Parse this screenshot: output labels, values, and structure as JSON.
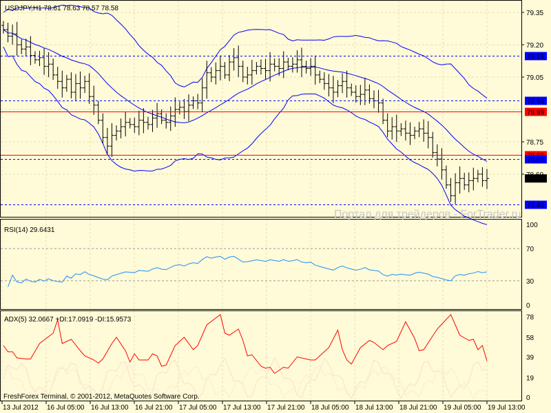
{
  "header": {
    "symbol_info": "USDJPY,H1  78.61 78.63 78.57 78.58"
  },
  "watermark": "Портал для трейдеров - ForTrader.ru",
  "footer": {
    "copyright": "FreshForex Terminal, © 2001-2012, MetaQuotes Software Corp."
  },
  "colors": {
    "background": "#fffad7",
    "bars": "#000000",
    "bands": "#0000ff",
    "level_red": "#ff0000",
    "level_blue": "#0000ff",
    "rsi": "#1e90ff",
    "adx": "#ff0000",
    "grid": "#e6e0b8"
  },
  "chart_data": [
    {
      "type": "bar",
      "title": "USDJPY,H1",
      "price_ticks": [
        "79.35",
        "79.20",
        "79.05",
        "78.75",
        "78.60"
      ],
      "ylim": [
        78.43,
        79.4
      ],
      "closes": [
        79.27,
        79.24,
        79.25,
        79.2,
        79.18,
        79.19,
        79.15,
        79.13,
        79.14,
        79.1,
        79.11,
        79.06,
        79.03,
        79.0,
        79.04,
        78.98,
        79.02,
        79.0,
        79.03,
        78.96,
        78.92,
        78.85,
        78.77,
        78.73,
        78.78,
        78.8,
        78.82,
        78.84,
        78.83,
        78.82,
        78.85,
        78.84,
        78.83,
        78.86,
        78.88,
        78.85,
        78.84,
        78.87,
        78.9,
        78.91,
        78.89,
        78.92,
        78.94,
        78.93,
        79.0,
        79.07,
        79.05,
        79.08,
        79.1,
        79.06,
        79.12,
        79.14,
        79.1,
        79.05,
        79.06,
        79.08,
        79.1,
        79.09,
        79.08,
        79.11,
        79.1,
        79.09,
        79.12,
        79.1,
        79.11,
        79.13,
        79.1,
        79.09,
        79.1,
        79.06,
        79.04,
        79.02,
        79.0,
        78.98,
        79.01,
        79.03,
        79.0,
        78.98,
        78.96,
        78.97,
        78.99,
        78.95,
        78.94,
        78.93,
        78.85,
        78.8,
        78.82,
        78.8,
        78.81,
        78.79,
        78.78,
        78.8,
        78.81,
        78.79,
        78.77,
        78.7,
        78.67,
        78.62,
        78.55,
        78.5,
        78.56,
        78.58,
        78.55,
        78.57,
        78.58,
        78.6,
        78.57,
        78.58
      ],
      "levels": [
        {
          "price": 79.15,
          "label": "79.15",
          "style": "blue-dashed"
        },
        {
          "price": 78.94,
          "label": "78.94",
          "style": "blue-dashed"
        },
        {
          "price": 78.89,
          "label": "78.89",
          "style": "red-solid"
        },
        {
          "price": 78.69,
          "label": "78.69",
          "style": "red-solid"
        },
        {
          "price": 78.67,
          "label": "78.67",
          "style": "blue-dashed"
        },
        {
          "price": 78.46,
          "label": "78.46",
          "style": "blue-dashed"
        }
      ],
      "current_price": "78.58"
    },
    {
      "type": "line",
      "title": "RSI(14) 29.6431",
      "ylim": [
        0,
        100
      ],
      "ticks": [
        "100",
        "70",
        "30",
        "0"
      ],
      "levels": [
        70,
        30
      ]
    },
    {
      "type": "line",
      "title": "ADX(5) 32.0667 +DI:17.0919 -DI:15.9573",
      "ylim": [
        0,
        78
      ],
      "ticks": [
        "78",
        "58",
        "39",
        "19",
        "0"
      ],
      "adx_points": [
        [
          0,
          50
        ],
        [
          1,
          44
        ],
        [
          2,
          44
        ],
        [
          3,
          38
        ],
        [
          5,
          37
        ],
        [
          6,
          37
        ],
        [
          8,
          52
        ],
        [
          11,
          62
        ],
        [
          12,
          75
        ],
        [
          13,
          52
        ],
        [
          15,
          56
        ],
        [
          17,
          45
        ],
        [
          18,
          40
        ],
        [
          20,
          36
        ],
        [
          21,
          33
        ],
        [
          22,
          37
        ],
        [
          24,
          52
        ],
        [
          25,
          58
        ],
        [
          27,
          45
        ],
        [
          28,
          34
        ],
        [
          29,
          42
        ],
        [
          30,
          36
        ],
        [
          32,
          36
        ],
        [
          33,
          42
        ],
        [
          34,
          40
        ],
        [
          35,
          30
        ],
        [
          36,
          31
        ],
        [
          38,
          50
        ],
        [
          40,
          58
        ],
        [
          42,
          46
        ],
        [
          43,
          50
        ],
        [
          45,
          70
        ],
        [
          48,
          80
        ],
        [
          49,
          62
        ],
        [
          50,
          60
        ],
        [
          52,
          66
        ],
        [
          53,
          55
        ],
        [
          54,
          40
        ],
        [
          55,
          41
        ],
        [
          57,
          30
        ],
        [
          58,
          28
        ],
        [
          59,
          29
        ],
        [
          60,
          23
        ],
        [
          62,
          29
        ],
        [
          63,
          28
        ],
        [
          65,
          39
        ],
        [
          68,
          36
        ],
        [
          69,
          36
        ],
        [
          72,
          48
        ],
        [
          74,
          65
        ],
        [
          75,
          46
        ],
        [
          76,
          36
        ],
        [
          77,
          32
        ],
        [
          79,
          48
        ],
        [
          81,
          55
        ],
        [
          82,
          53
        ],
        [
          84,
          46
        ],
        [
          85,
          50
        ],
        [
          87,
          54
        ],
        [
          89,
          73
        ],
        [
          91,
          57
        ],
        [
          92,
          45
        ],
        [
          93,
          46
        ],
        [
          96,
          66
        ],
        [
          99,
          80
        ],
        [
          101,
          60
        ],
        [
          103,
          55
        ],
        [
          104,
          56
        ],
        [
          105,
          46
        ],
        [
          106,
          50
        ],
        [
          107,
          35
        ]
      ]
    }
  ],
  "time_axis": [
    "13 Jul 2012",
    "16 Jul 05:00",
    "16 Jul 13:00",
    "16 Jul 21:00",
    "17 Jul 05:00",
    "17 Jul 13:00",
    "17 Jul 21:00",
    "18 Jul 05:00",
    "18 Jul 13:00",
    "18 Jul 21:00",
    "19 Jul 05:00",
    "19 Jul 13:00"
  ]
}
